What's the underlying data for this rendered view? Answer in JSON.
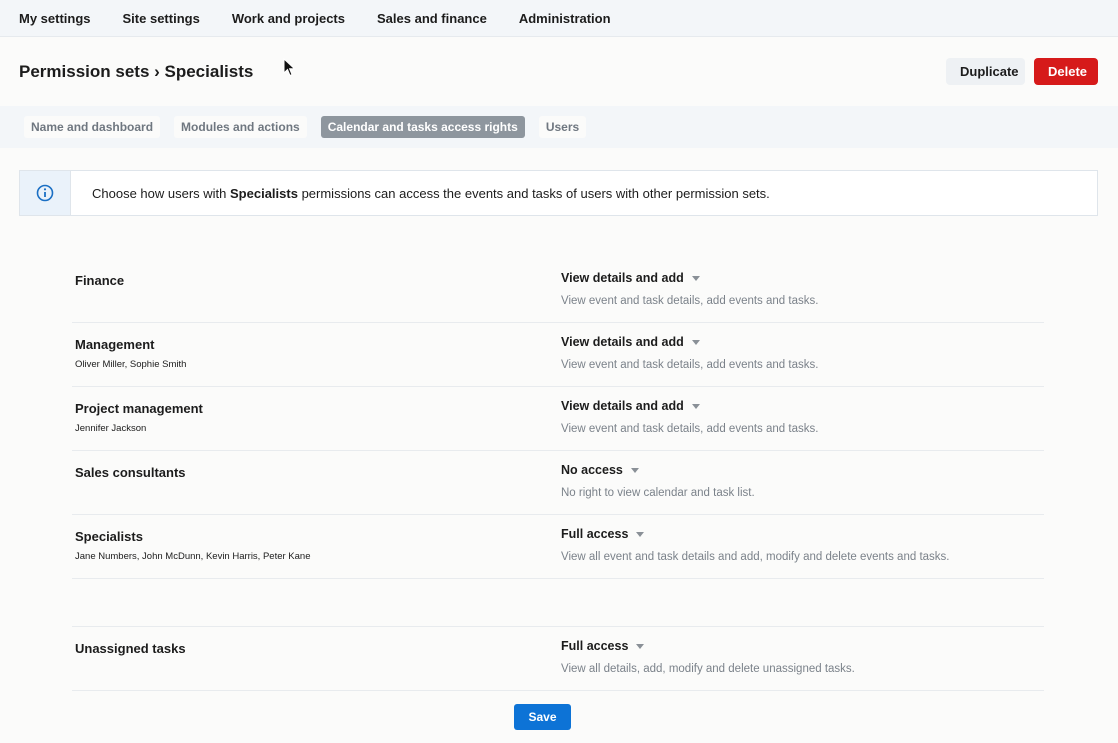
{
  "topnav": {
    "items": [
      "My settings",
      "Site settings",
      "Work and projects",
      "Sales and finance",
      "Administration"
    ]
  },
  "header": {
    "title": "Permission sets › Specialists",
    "duplicate_label": "Duplicate",
    "delete_label": "Delete"
  },
  "tabs": [
    {
      "label": "Name and dashboard",
      "active": false
    },
    {
      "label": "Modules and actions",
      "active": false
    },
    {
      "label": "Calendar and tasks access rights",
      "active": true
    },
    {
      "label": "Users",
      "active": false
    }
  ],
  "info": {
    "prefix": "Choose how users with ",
    "bold": "Specialists",
    "suffix": " permissions can access the events and tasks of users with other permission sets."
  },
  "rows": [
    {
      "name": "Finance",
      "users": "",
      "access": "View details and add",
      "desc": "View event and task details, add events and tasks."
    },
    {
      "name": "Management",
      "users": "Oliver Miller, Sophie Smith",
      "access": "View details and add",
      "desc": "View event and task details, add events and tasks."
    },
    {
      "name": "Project management",
      "users": "Jennifer Jackson",
      "access": "View details and add",
      "desc": "View event and task details, add events and tasks."
    },
    {
      "name": "Sales consultants",
      "users": "",
      "access": "No access",
      "desc": "No right to view calendar and task list."
    },
    {
      "name": "Specialists",
      "users": "Jane Numbers, John McDunn, Kevin Harris, Peter Kane",
      "access": "Full access",
      "desc": "View all event and task details and add, modify and delete events and tasks."
    }
  ],
  "unassigned": {
    "name": "Unassigned tasks",
    "users": "",
    "access": "Full access",
    "desc": "View all details, add, modify and delete unassigned tasks."
  },
  "save_label": "Save",
  "colors": {
    "primary": "#0d73d6",
    "danger": "#d61a1a",
    "active_tab": "#8e969e"
  }
}
